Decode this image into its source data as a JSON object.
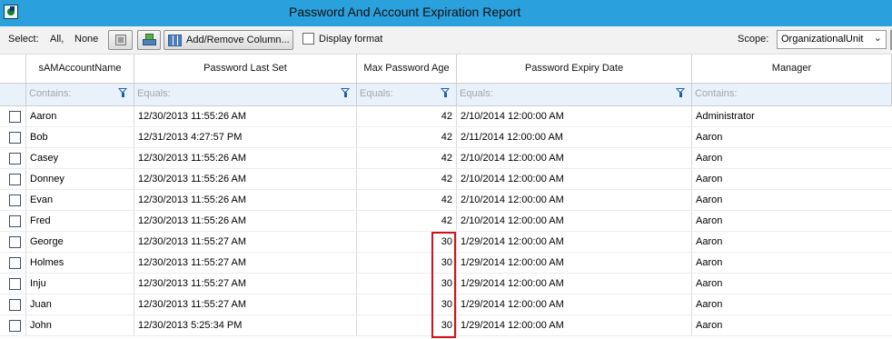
{
  "window": {
    "title": "Password And Account Expiration Report"
  },
  "toolbar": {
    "select_label": "Select:",
    "all_label": "All,",
    "none_label": "None",
    "add_remove_columns_label": "Add/Remove Column...",
    "display_format_label": "Display format",
    "scope_label": "Scope:",
    "scope_value": "OrganizationalUnit"
  },
  "table": {
    "columns": [
      "sAMAccountName",
      "Password Last Set",
      "Max Password Age",
      "Password Expiry Date",
      "Manager"
    ],
    "filters": [
      "Contains:",
      "Equals:",
      "Equals:",
      "Equals:",
      "Contains:"
    ],
    "rows": [
      {
        "name": "Aaron",
        "last_set": "12/30/2013 11:55:26 AM",
        "max_age": "42",
        "expiry": "2/10/2014 12:00:00 AM",
        "manager": "Administrator"
      },
      {
        "name": "Bob",
        "last_set": "12/31/2013 4:27:57 PM",
        "max_age": "42",
        "expiry": "2/11/2014 12:00:00 AM",
        "manager": "Aaron"
      },
      {
        "name": "Casey",
        "last_set": "12/30/2013 11:55:26 AM",
        "max_age": "42",
        "expiry": "2/10/2014 12:00:00 AM",
        "manager": "Aaron"
      },
      {
        "name": "Donney",
        "last_set": "12/30/2013 11:55:26 AM",
        "max_age": "42",
        "expiry": "2/10/2014 12:00:00 AM",
        "manager": "Aaron"
      },
      {
        "name": "Evan",
        "last_set": "12/30/2013 11:55:26 AM",
        "max_age": "42",
        "expiry": "2/10/2014 12:00:00 AM",
        "manager": "Aaron"
      },
      {
        "name": "Fred",
        "last_set": "12/30/2013 11:55:26 AM",
        "max_age": "42",
        "expiry": "2/10/2014 12:00:00 AM",
        "manager": "Aaron"
      },
      {
        "name": "George",
        "last_set": "12/30/2013 11:55:27 AM",
        "max_age": "30",
        "expiry": "1/29/2014 12:00:00 AM",
        "manager": "Aaron"
      },
      {
        "name": "Holmes",
        "last_set": "12/30/2013 11:55:27 AM",
        "max_age": "30",
        "expiry": "1/29/2014 12:00:00 AM",
        "manager": "Aaron"
      },
      {
        "name": "Inju",
        "last_set": "12/30/2013 11:55:27 AM",
        "max_age": "30",
        "expiry": "1/29/2014 12:00:00 AM",
        "manager": "Aaron"
      },
      {
        "name": "Juan",
        "last_set": "12/30/2013 11:55:27 AM",
        "max_age": "30",
        "expiry": "1/29/2014 12:00:00 AM",
        "manager": "Aaron"
      },
      {
        "name": "John",
        "last_set": "12/30/2013 5:25:34 PM",
        "max_age": "30",
        "expiry": "1/29/2014 12:00:00 AM",
        "manager": "Aaron"
      }
    ]
  },
  "colors": {
    "titlebar": "#2aa0dd",
    "filter_row": "#e9f1fb",
    "highlight": "#d1121b",
    "funnel": "#1e5fa8"
  },
  "icons": [
    "app-icon",
    "export-icon",
    "print-icon",
    "columns-icon",
    "filter-icon",
    "chevron-down-icon"
  ]
}
